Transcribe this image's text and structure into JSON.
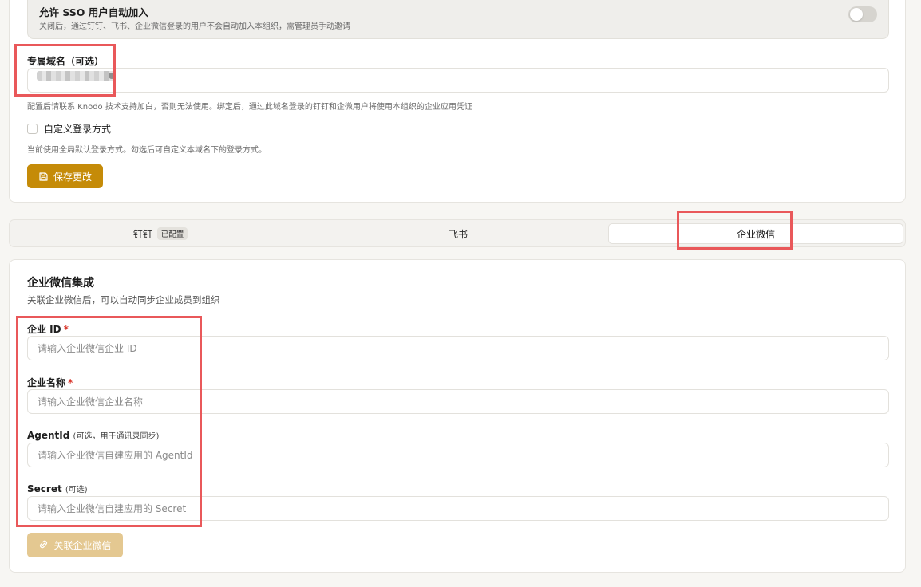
{
  "sso": {
    "title": "允许 SSO 用户自动加入",
    "description": "关闭后，通过钉钉、飞书、企业微信登录的用户不会自动加入本组织，需管理员手动邀请",
    "enabled": false
  },
  "domain": {
    "label": "专属域名（可选）",
    "help": "配置后请联系 Knodo 技术支持加白，否则无法使用。绑定后，通过此域名登录的钉钉和企微用户将使用本组织的企业应用凭证"
  },
  "custom_login": {
    "label": "自定义登录方式",
    "help": "当前使用全局默认登录方式。勾选后可自定义本域名下的登录方式。",
    "checked": false
  },
  "save_button": {
    "label": "保存更改"
  },
  "tabs": [
    {
      "label": "钉钉",
      "badge": "已配置"
    },
    {
      "label": "飞书"
    },
    {
      "label": "企业微信",
      "active": true
    }
  ],
  "wecom": {
    "title": "企业微信集成",
    "subtitle": "关联企业微信后，可以自动同步企业成员到组织",
    "corp_id": {
      "label": "企业 ID",
      "required_mark": "*",
      "placeholder": "请输入企业微信企业 ID"
    },
    "corp_name": {
      "label": "企业名称",
      "required_mark": "*",
      "placeholder": "请输入企业微信企业名称"
    },
    "agent_id": {
      "label": "AgentId",
      "note": "(可选，用于通讯录同步)",
      "placeholder": "请输入企业微信自建应用的 AgentId"
    },
    "secret": {
      "label": "Secret",
      "note": "(可选)",
      "placeholder": "请输入企业微信自建应用的 Secret"
    },
    "link_button": {
      "label": "关联企业微信"
    }
  },
  "colors": {
    "accent": "#c58b08",
    "accent_disabled": "#e4c891",
    "highlight": "#e9585a",
    "required": "#d9362b"
  }
}
